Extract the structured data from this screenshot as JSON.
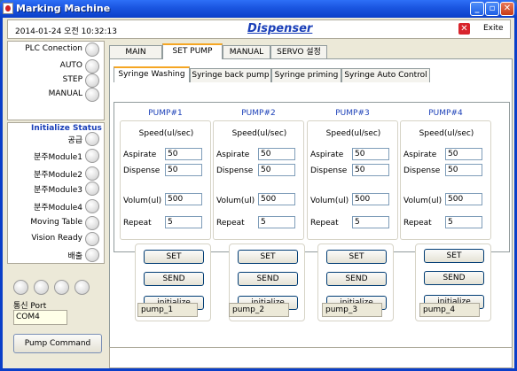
{
  "window": {
    "title": "Marking Machine"
  },
  "header": {
    "datetime": "2014-01-24 오전 10:32:13",
    "title": "Dispenser",
    "exit_label": "Exite"
  },
  "left": {
    "plc_label": "PLC Conection",
    "mode_items": [
      "AUTO",
      "STEP",
      "MANUAL"
    ],
    "status_title": "Initialize  Status",
    "status_items": [
      "공급",
      "분주Module1",
      "분주Module2",
      "분주Module3",
      "분주Module4",
      "Moving Table",
      "Vision Ready",
      "배출"
    ],
    "port_label": "통신 Port",
    "port_value": "COM4",
    "pump_command_label": "Pump Command"
  },
  "tabs": [
    "MAIN",
    "SET PUMP",
    "MANUAL",
    "SERVO 설정"
  ],
  "subtabs": [
    "Syringe Washing",
    "Syringe back pump",
    "Syringe priming",
    "Syringe Auto Control"
  ],
  "field_labels": {
    "speed": "Speed(ul/sec)",
    "aspirate": "Aspirate",
    "dispense": "Dispense",
    "volum": "Volum(ul)",
    "repeat": "Repeat"
  },
  "pumps": [
    {
      "title": "PUMP#1",
      "aspirate": "50",
      "dispense": "50",
      "volum": "500",
      "repeat": "5",
      "name": "pump_1"
    },
    {
      "title": "PUMP#2",
      "aspirate": "50",
      "dispense": "50",
      "volum": "500",
      "repeat": "5",
      "name": "pump_2"
    },
    {
      "title": "PUMP#3",
      "aspirate": "50",
      "dispense": "50",
      "volum": "500",
      "repeat": "5",
      "name": "pump_3"
    },
    {
      "title": "PUMP#4",
      "aspirate": "50",
      "dispense": "50",
      "volum": "500",
      "repeat": "5",
      "name": "pump_4"
    }
  ],
  "buttons": {
    "set": "SET",
    "send": "SEND",
    "initialize": "initialize"
  },
  "colors": {
    "titlebar": "#0b3fc8",
    "accent_blue": "#1a3fb8",
    "tab_highlight": "#f5a623",
    "exit_red": "#d8242c"
  }
}
